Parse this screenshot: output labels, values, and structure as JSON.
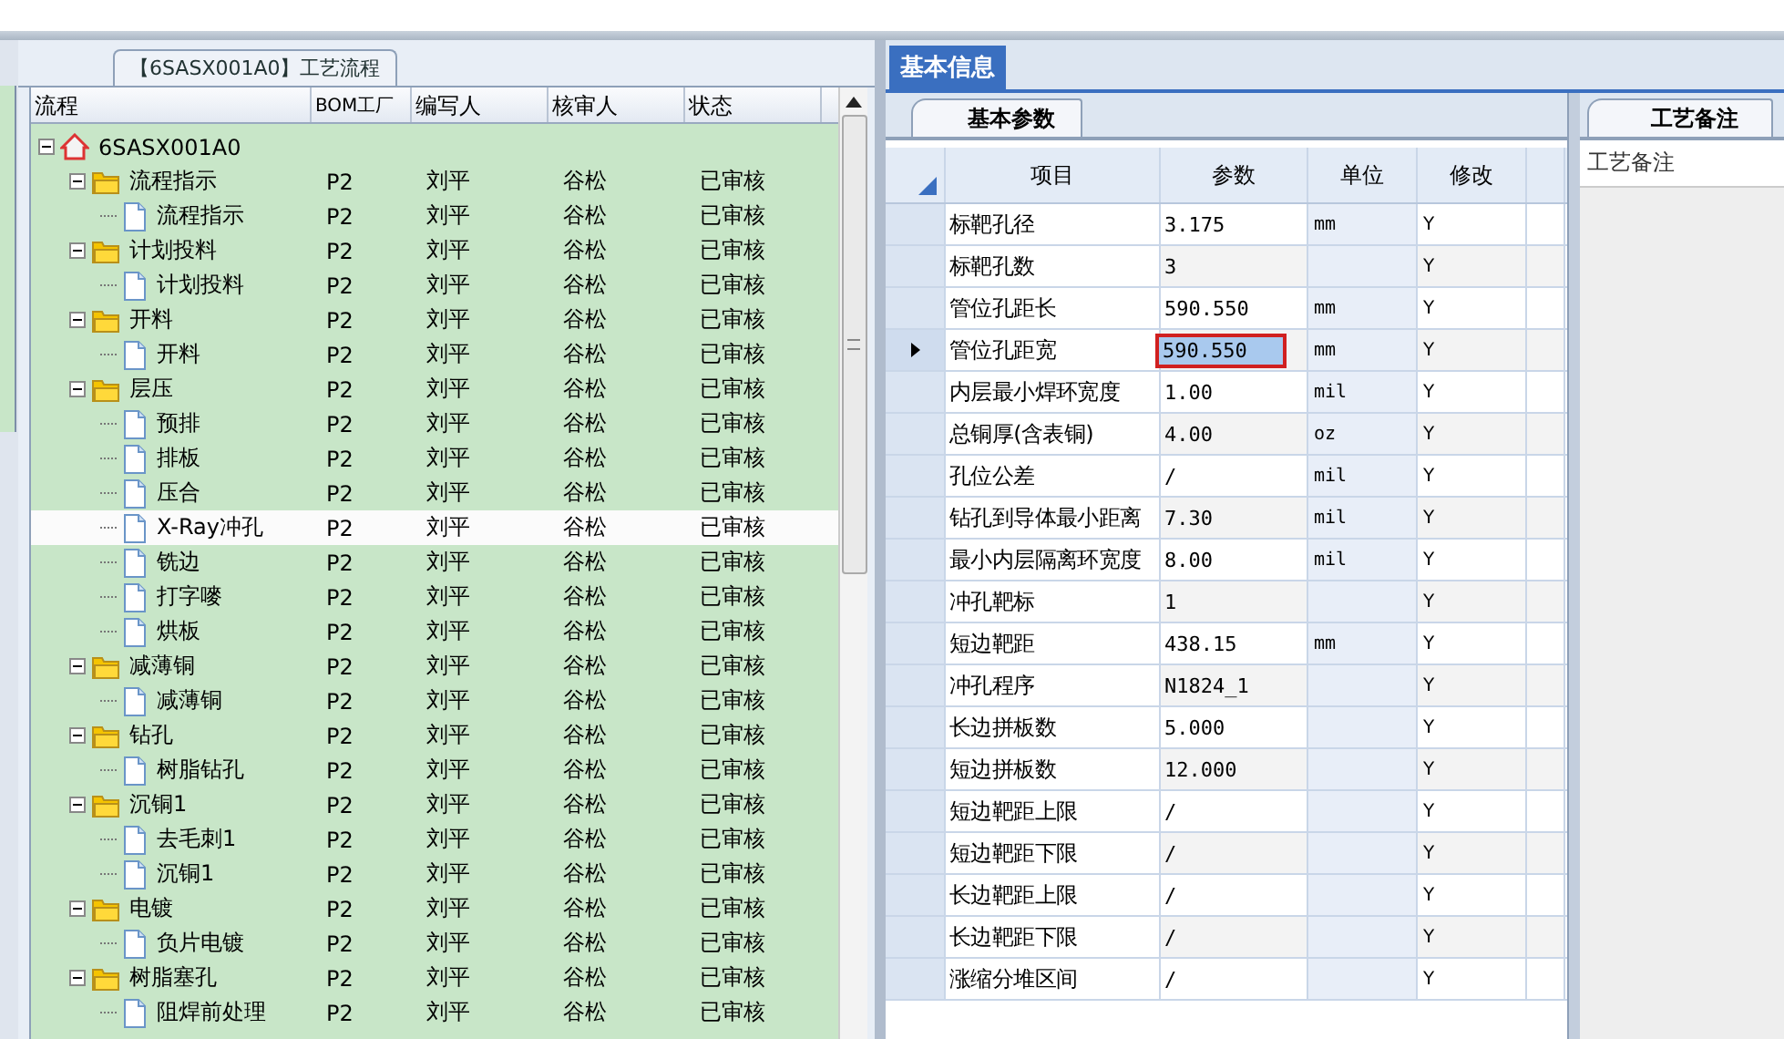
{
  "process_panel": {
    "title": "【6SASX001A0】工艺流程",
    "columns": [
      "流程",
      "BOM工厂",
      "编写人",
      "核审人",
      "状态"
    ],
    "tree": [
      {
        "kind": "root",
        "name": "6SASX001A0",
        "expanded": true,
        "selected": false,
        "children": [
          {
            "kind": "folder",
            "name": "流程指示",
            "plant": "P2",
            "author": "刘平",
            "reviewer": "谷松",
            "status": "已审核",
            "expanded": true,
            "selected": false,
            "children": [
              {
                "kind": "file",
                "name": "流程指示",
                "plant": "P2",
                "author": "刘平",
                "reviewer": "谷松",
                "status": "已审核",
                "selected": false
              }
            ]
          },
          {
            "kind": "folder",
            "name": "计划投料",
            "plant": "P2",
            "author": "刘平",
            "reviewer": "谷松",
            "status": "已审核",
            "expanded": true,
            "selected": false,
            "children": [
              {
                "kind": "file",
                "name": "计划投料",
                "plant": "P2",
                "author": "刘平",
                "reviewer": "谷松",
                "status": "已审核",
                "selected": false
              }
            ]
          },
          {
            "kind": "folder",
            "name": "开料",
            "plant": "P2",
            "author": "刘平",
            "reviewer": "谷松",
            "status": "已审核",
            "expanded": true,
            "selected": false,
            "children": [
              {
                "kind": "file",
                "name": "开料",
                "plant": "P2",
                "author": "刘平",
                "reviewer": "谷松",
                "status": "已审核",
                "selected": false
              }
            ]
          },
          {
            "kind": "folder",
            "name": "层压",
            "plant": "P2",
            "author": "刘平",
            "reviewer": "谷松",
            "status": "已审核",
            "expanded": true,
            "selected": false,
            "children": [
              {
                "kind": "file",
                "name": "预排",
                "plant": "P2",
                "author": "刘平",
                "reviewer": "谷松",
                "status": "已审核",
                "selected": false
              },
              {
                "kind": "file",
                "name": "排板",
                "plant": "P2",
                "author": "刘平",
                "reviewer": "谷松",
                "status": "已审核",
                "selected": false
              },
              {
                "kind": "file",
                "name": "压合",
                "plant": "P2",
                "author": "刘平",
                "reviewer": "谷松",
                "status": "已审核",
                "selected": false
              },
              {
                "kind": "file",
                "name": "X-Ray冲孔",
                "plant": "P2",
                "author": "刘平",
                "reviewer": "谷松",
                "status": "已审核",
                "selected": true
              },
              {
                "kind": "file",
                "name": "铣边",
                "plant": "P2",
                "author": "刘平",
                "reviewer": "谷松",
                "status": "已审核",
                "selected": false
              },
              {
                "kind": "file",
                "name": "打字嘜",
                "plant": "P2",
                "author": "刘平",
                "reviewer": "谷松",
                "status": "已审核",
                "selected": false
              },
              {
                "kind": "file",
                "name": "烘板",
                "plant": "P2",
                "author": "刘平",
                "reviewer": "谷松",
                "status": "已审核",
                "selected": false
              }
            ]
          },
          {
            "kind": "folder",
            "name": "减薄铜",
            "plant": "P2",
            "author": "刘平",
            "reviewer": "谷松",
            "status": "已审核",
            "expanded": true,
            "selected": false,
            "children": [
              {
                "kind": "file",
                "name": "减薄铜",
                "plant": "P2",
                "author": "刘平",
                "reviewer": "谷松",
                "status": "已审核",
                "selected": false
              }
            ]
          },
          {
            "kind": "folder",
            "name": "钻孔",
            "plant": "P2",
            "author": "刘平",
            "reviewer": "谷松",
            "status": "已审核",
            "expanded": true,
            "selected": false,
            "children": [
              {
                "kind": "file",
                "name": "树脂钻孔",
                "plant": "P2",
                "author": "刘平",
                "reviewer": "谷松",
                "status": "已审核",
                "selected": false
              }
            ]
          },
          {
            "kind": "folder",
            "name": "沉铜1",
            "plant": "P2",
            "author": "刘平",
            "reviewer": "谷松",
            "status": "已审核",
            "expanded": true,
            "selected": false,
            "children": [
              {
                "kind": "file",
                "name": "去毛刺1",
                "plant": "P2",
                "author": "刘平",
                "reviewer": "谷松",
                "status": "已审核",
                "selected": false
              },
              {
                "kind": "file",
                "name": "沉铜1",
                "plant": "P2",
                "author": "刘平",
                "reviewer": "谷松",
                "status": "已审核",
                "selected": false
              }
            ]
          },
          {
            "kind": "folder",
            "name": "电镀",
            "plant": "P2",
            "author": "刘平",
            "reviewer": "谷松",
            "status": "已审核",
            "expanded": true,
            "selected": false,
            "children": [
              {
                "kind": "file",
                "name": "负片电镀",
                "plant": "P2",
                "author": "刘平",
                "reviewer": "谷松",
                "status": "已审核",
                "selected": false
              }
            ]
          },
          {
            "kind": "folder",
            "name": "树脂塞孔",
            "plant": "P2",
            "author": "刘平",
            "reviewer": "谷松",
            "status": "已审核",
            "expanded": true,
            "selected": false,
            "children": [
              {
                "kind": "file",
                "name": "阻焊前处理",
                "plant": "P2",
                "author": "刘平",
                "reviewer": "谷松",
                "status": "已审核",
                "selected": false
              }
            ]
          }
        ]
      }
    ]
  },
  "info_panel": {
    "tab": "基本信息",
    "subtab": "基本参数",
    "columns": [
      "项目",
      "参数",
      "单位",
      "修改"
    ],
    "rows": [
      {
        "item": "标靶孔径",
        "value": "3.175",
        "unit": "mm",
        "modify": "Y",
        "selected": false
      },
      {
        "item": "标靶孔数",
        "value": "3",
        "unit": "",
        "modify": "Y",
        "selected": false
      },
      {
        "item": "管位孔距长",
        "value": "590.550",
        "unit": "mm",
        "modify": "Y",
        "selected": false
      },
      {
        "item": "管位孔距宽",
        "value": "590.550",
        "unit": "mm",
        "modify": "Y",
        "selected": true
      },
      {
        "item": "内层最小焊环宽度",
        "value": "1.00",
        "unit": "mil",
        "modify": "Y",
        "selected": false
      },
      {
        "item": "总铜厚(含表铜)",
        "value": "4.00",
        "unit": "oz",
        "modify": "Y",
        "selected": false
      },
      {
        "item": "孔位公差",
        "value": "/",
        "unit": "mil",
        "modify": "Y",
        "selected": false
      },
      {
        "item": "钻孔到导体最小距离",
        "value": "7.30",
        "unit": "mil",
        "modify": "Y",
        "selected": false
      },
      {
        "item": "最小内层隔离环宽度",
        "value": "8.00",
        "unit": "mil",
        "modify": "Y",
        "selected": false
      },
      {
        "item": "冲孔靶标",
        "value": "1",
        "unit": "",
        "modify": "Y",
        "selected": false
      },
      {
        "item": "短边靶距",
        "value": "438.15",
        "unit": "mm",
        "modify": "Y",
        "selected": false
      },
      {
        "item": "冲孔程序",
        "value": "N1824_1",
        "unit": "",
        "modify": "Y",
        "selected": false
      },
      {
        "item": "长边拼板数",
        "value": "5.000",
        "unit": "",
        "modify": "Y",
        "selected": false
      },
      {
        "item": "短边拼板数",
        "value": "12.000",
        "unit": "",
        "modify": "Y",
        "selected": false
      },
      {
        "item": "短边靶距上限",
        "value": "/",
        "unit": "",
        "modify": "Y",
        "selected": false
      },
      {
        "item": "短边靶距下限",
        "value": "/",
        "unit": "",
        "modify": "Y",
        "selected": false
      },
      {
        "item": "长边靶距上限",
        "value": "/",
        "unit": "",
        "modify": "Y",
        "selected": false
      },
      {
        "item": "长边靶距下限",
        "value": "/",
        "unit": "",
        "modify": "Y",
        "selected": false
      },
      {
        "item": "涨缩分堆区间",
        "value": "/",
        "unit": "",
        "modify": "Y",
        "selected": false
      }
    ]
  },
  "notes_panel": {
    "tab": "工艺备注",
    "label": "工艺备注"
  }
}
